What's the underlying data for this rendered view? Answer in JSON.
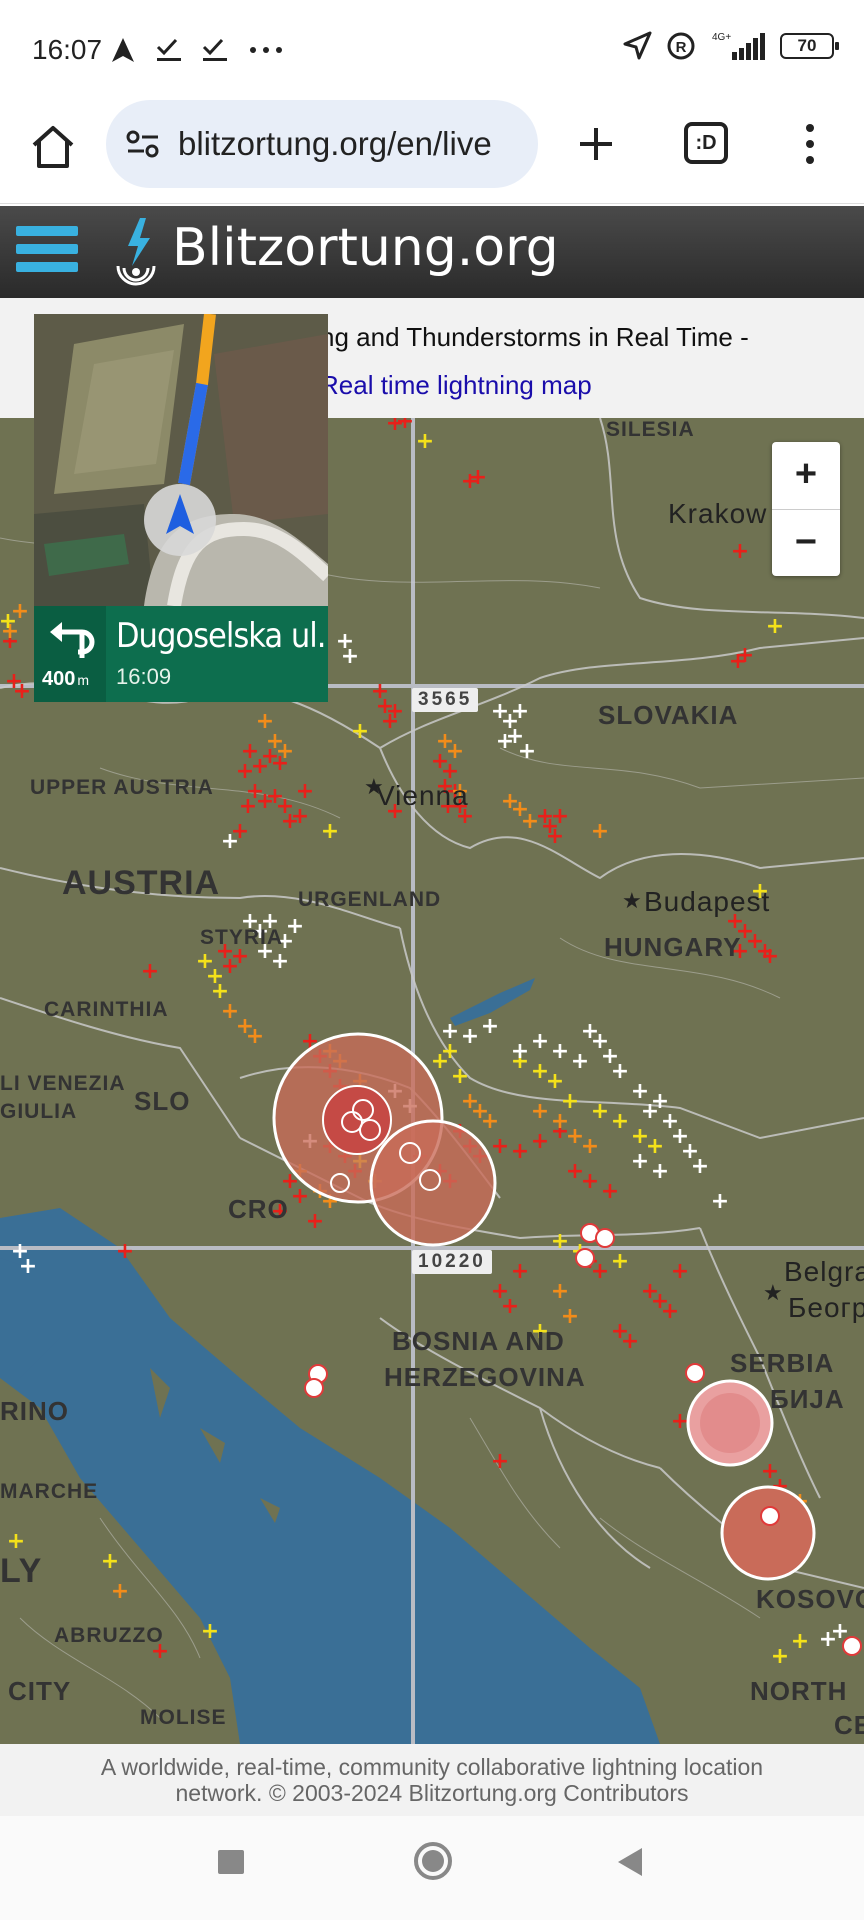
{
  "status": {
    "time": "16:07",
    "network": "4G+",
    "battery": "70"
  },
  "browser": {
    "url": "blitzortung.org/en/live",
    "tabs_label": ":D"
  },
  "site": {
    "title": "Blitzortung.org",
    "subtitle_visible": "ng and Thunderstorms in Real Time -",
    "link_visible": "Real time lightning map"
  },
  "map": {
    "zoom_in": "+",
    "zoom_out": "−",
    "grid_numbers": {
      "top": "3565",
      "bottom": "10220"
    },
    "labels": {
      "silesia": "SILESIA",
      "krakow": "Krakow",
      "slovakia": "SLOVAKIA",
      "upper_austria": "UPPER AUSTRIA",
      "vienna": "Vienna",
      "austria": "AUSTRIA",
      "burgenland": "URGENLAND",
      "styria": "STYRIA",
      "budapest": "Budapest",
      "hungary": "HUNGARY",
      "carinthia": "CARINTHIA",
      "friuli": "LI VENEZIA",
      "giulia": "GIULIA",
      "slovenia": "SLO",
      "croatia": "CRO",
      "belgrade": "Belgra",
      "belgrade_cyr": "Беогр",
      "bosnia": "BOSNIA AND",
      "herzegovina": "HERZEGOVINA",
      "serbia": "SERBIA",
      "serbia_cyr": "БИЈА",
      "marino": "RINO",
      "marche": "MARCHE",
      "italy": "LY",
      "abruzzo": "ABRUZZO",
      "city": "CITY",
      "molise": "MOLISE",
      "kosovo": "KOSOVO",
      "north": "NORTH",
      "ce": "CE"
    }
  },
  "navigation": {
    "street": "Dugoselska ul.",
    "distance": "400",
    "distance_unit": "m",
    "eta": "16:09"
  },
  "footer": {
    "line1": "A worldwide, real-time, community collaborative lightning location",
    "line2": "network. © 2003-2024 Blitzortung.org Contributors"
  },
  "colors": {
    "accent": "#39b1e0",
    "header_bg": "#333333",
    "map_land": "#6f7252",
    "sea": "#3a6f96",
    "nav_green": "#0d6e4e",
    "link": "#1a0dab"
  }
}
